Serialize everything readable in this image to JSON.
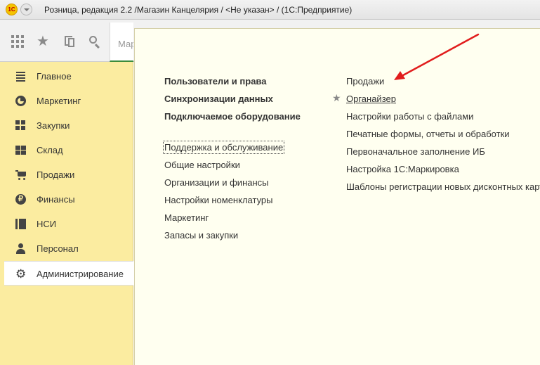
{
  "window": {
    "title": "Розница, редакция 2.2 /Магазин Канцелярия / <Не указан> /  (1С:Предприятие)",
    "logo_text": "1С"
  },
  "toolbar": {
    "icons": [
      "apps-grid-icon",
      "star-icon",
      "history-icon",
      "search-icon"
    ],
    "tab_label": "Мар"
  },
  "sidebar": {
    "items": [
      {
        "label": "Главное",
        "icon": "list-icon",
        "active": false
      },
      {
        "label": "Маркетинг",
        "icon": "pie-chart-icon",
        "active": false
      },
      {
        "label": "Закупки",
        "icon": "purchases-icon",
        "active": false
      },
      {
        "label": "Склад",
        "icon": "warehouse-icon",
        "active": false
      },
      {
        "label": "Продажи",
        "icon": "cart-icon",
        "active": false
      },
      {
        "label": "Финансы",
        "icon": "ruble-icon",
        "active": false
      },
      {
        "label": "НСИ",
        "icon": "reference-data-icon",
        "active": false
      },
      {
        "label": "Персонал",
        "icon": "person-icon",
        "active": false
      },
      {
        "label": "Администрирование",
        "icon": "gear-icon",
        "active": true
      }
    ]
  },
  "content": {
    "column1_bold": [
      "Пользователи и права",
      "Синхронизации данных",
      "Подключаемое оборудование"
    ],
    "column1": [
      "Поддержка и обслуживание",
      "Общие настройки",
      "Организации и финансы",
      "Настройки номенклатуры",
      "Маркетинг",
      "Запасы и закупки"
    ],
    "column2": [
      "Продажи",
      "Органайзер",
      "Настройки работы с файлами",
      "Печатные формы, отчеты и обработки",
      "Первоначальное заполнение ИБ",
      "Настройка 1С:Маркировка",
      "Шаблоны регистрации новых дисконтных карт"
    ]
  },
  "colors": {
    "sidebar_bg": "#fbeca0",
    "content_bg": "#fffff0",
    "annotation_arrow": "#e11d1d",
    "active_tab_underline": "#3c8c3c"
  }
}
